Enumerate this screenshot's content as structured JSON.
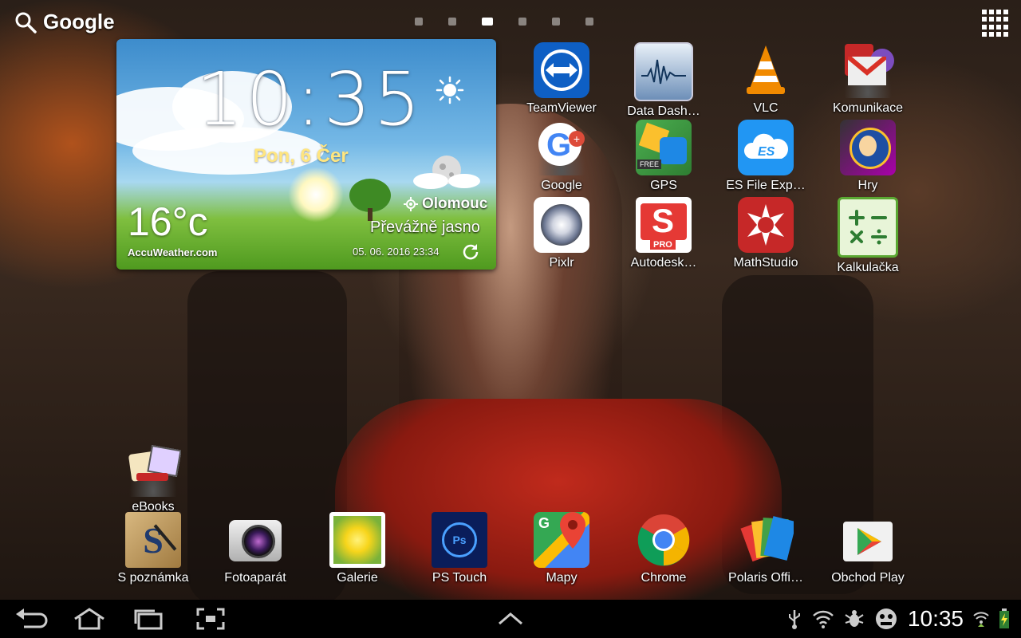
{
  "top_bar": {
    "search_label": "Google",
    "page_count": 6,
    "active_page": 3
  },
  "weather": {
    "time": "10:35",
    "date": "Pon, 6 Čer",
    "temperature": "16°c",
    "city": "Olomouc",
    "condition": "Převážně jasno",
    "brand": "AccuWeather.com",
    "updated": "05. 06. 2016 23:34"
  },
  "apps": [
    {
      "label": "TeamViewer",
      "icon": "teamviewer-icon"
    },
    {
      "label": "Data Dash…",
      "icon": "data-dashboard-icon"
    },
    {
      "label": "VLC",
      "icon": "vlc-cone-icon"
    },
    {
      "label": "Komunikace",
      "icon": "folder-communication-icon"
    },
    {
      "label": "Google",
      "icon": "folder-google-icon"
    },
    {
      "label": "GPS",
      "icon": "folder-gps-icon"
    },
    {
      "label": "ES File Exp…",
      "icon": "es-file-explorer-icon"
    },
    {
      "label": "Hry",
      "icon": "folder-games-icon"
    },
    {
      "label": "Pixlr",
      "icon": "pixlr-lens-icon"
    },
    {
      "label": "Autodesk…",
      "icon": "autodesk-sketchbook-icon"
    },
    {
      "label": "MathStudio",
      "icon": "mathstudio-icon"
    },
    {
      "label": "Kalkulačka",
      "icon": "calculator-icon"
    },
    {
      "label": "eBooks",
      "icon": "folder-ebooks-icon"
    }
  ],
  "dock": [
    {
      "label": "S poznámka",
      "icon": "s-note-icon"
    },
    {
      "label": "Fotoaparát",
      "icon": "camera-icon"
    },
    {
      "label": "Galerie",
      "icon": "gallery-icon"
    },
    {
      "label": "PS Touch",
      "icon": "ps-touch-icon"
    },
    {
      "label": "Mapy",
      "icon": "maps-icon"
    },
    {
      "label": "Chrome",
      "icon": "chrome-icon"
    },
    {
      "label": "Polaris Offi…",
      "icon": "polaris-office-icon"
    },
    {
      "label": "Obchod Play",
      "icon": "play-store-icon"
    }
  ],
  "status_bar": {
    "clock": "10:35",
    "icons": [
      "usb-icon",
      "wifi-icon",
      "bug-icon",
      "monster-icon",
      "wifi-signal-icon",
      "battery-icon"
    ]
  },
  "colors": {
    "accent_teamviewer": "#0e5fc4",
    "vlc_orange": "#f18a00",
    "navbar_bg": "#000000"
  }
}
